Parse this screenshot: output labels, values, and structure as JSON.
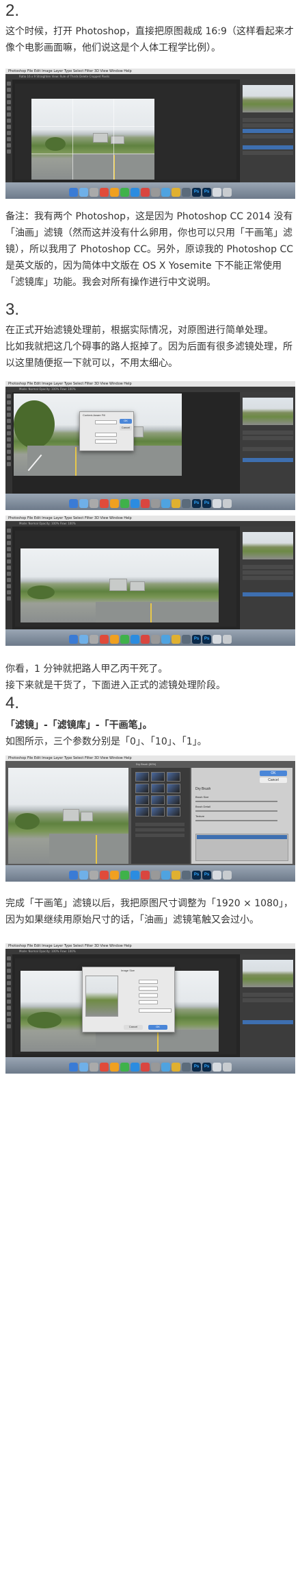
{
  "section2": {
    "number": "2.",
    "text": "这个时候，打开 Photoshop，直接把原图裁成 16:9（这样看起来才像个电影画面嘛，他们说这是个人体工程学比例）。"
  },
  "note": {
    "text": "备注：我有两个 Photoshop，这是因为 Photoshop CC 2014 没有「油画」滤镜（然而这并没有什么卵用，你也可以只用「干画笔」滤镜），所以我用了 Photoshop CC。另外，原谅我的 Photoshop CC 是英文版的，因为简体中文版在 OS X Yosemite 下不能正常使用「滤镜库」功能。我会对所有操作进行中文说明。"
  },
  "section3": {
    "number": "3.",
    "line1": "在正式开始滤镜处理前，根据实际情况，对原图进行简单处理。",
    "line2": "比如我就把这几个碍事的路人抠掉了。因为后面有很多滤镜处理，所以这里随便抠一下就可以，不用太细心。"
  },
  "after_cleanup": {
    "line1": "你看，1 分钟就把路人甲乙丙干死了。",
    "line2": "接下来就是干货了，下面进入正式的滤镜处理阶段。"
  },
  "section4": {
    "number": "4.",
    "path": "「滤镜」-「滤镜库」-「干画笔」。",
    "params": "如图所示，三个参数分别是「0」、「10」、「1」。"
  },
  "resize": {
    "text": "完成「干画笔」滤镜以后，我把原图尺寸调整为「1920 × 1080」，因为如果继续用原始尺寸的话，「油画」滤镜笔触又会过小。"
  },
  "screenshot": {
    "menu": "Photoshop  File  Edit  Image  Layer  Type  Select  Filter  3D  View  Window  Help",
    "options_crop": "Ratio   16   x   9   Straighten   View: Rule of Thirds   Delete Cropped Pixels",
    "options_brush": "Mode: Normal   Opacity: 100%   Flow: 100%",
    "doc_title": "IMG_4215.JPG @ 50% (RGB/8)",
    "filter_gallery_title": "Dry Brush (50%)",
    "filter_ok": "OK",
    "filter_cancel": "Cancel",
    "filter_name": "Dry Brush",
    "filter_brush_size": "Brush Size",
    "filter_brush_detail": "Brush Detail",
    "filter_texture": "Texture",
    "image_size_title": "Image Size",
    "content_aware_title": "Content-Aware Fill",
    "dock_ps": "Ps",
    "layers_label": "Layers",
    "background_label": "Background"
  },
  "colors": {
    "text": "#333333",
    "ps_dark": "#252525",
    "ps_panel": "#3c3c3c",
    "ps_blue": "#3e6fb0"
  }
}
